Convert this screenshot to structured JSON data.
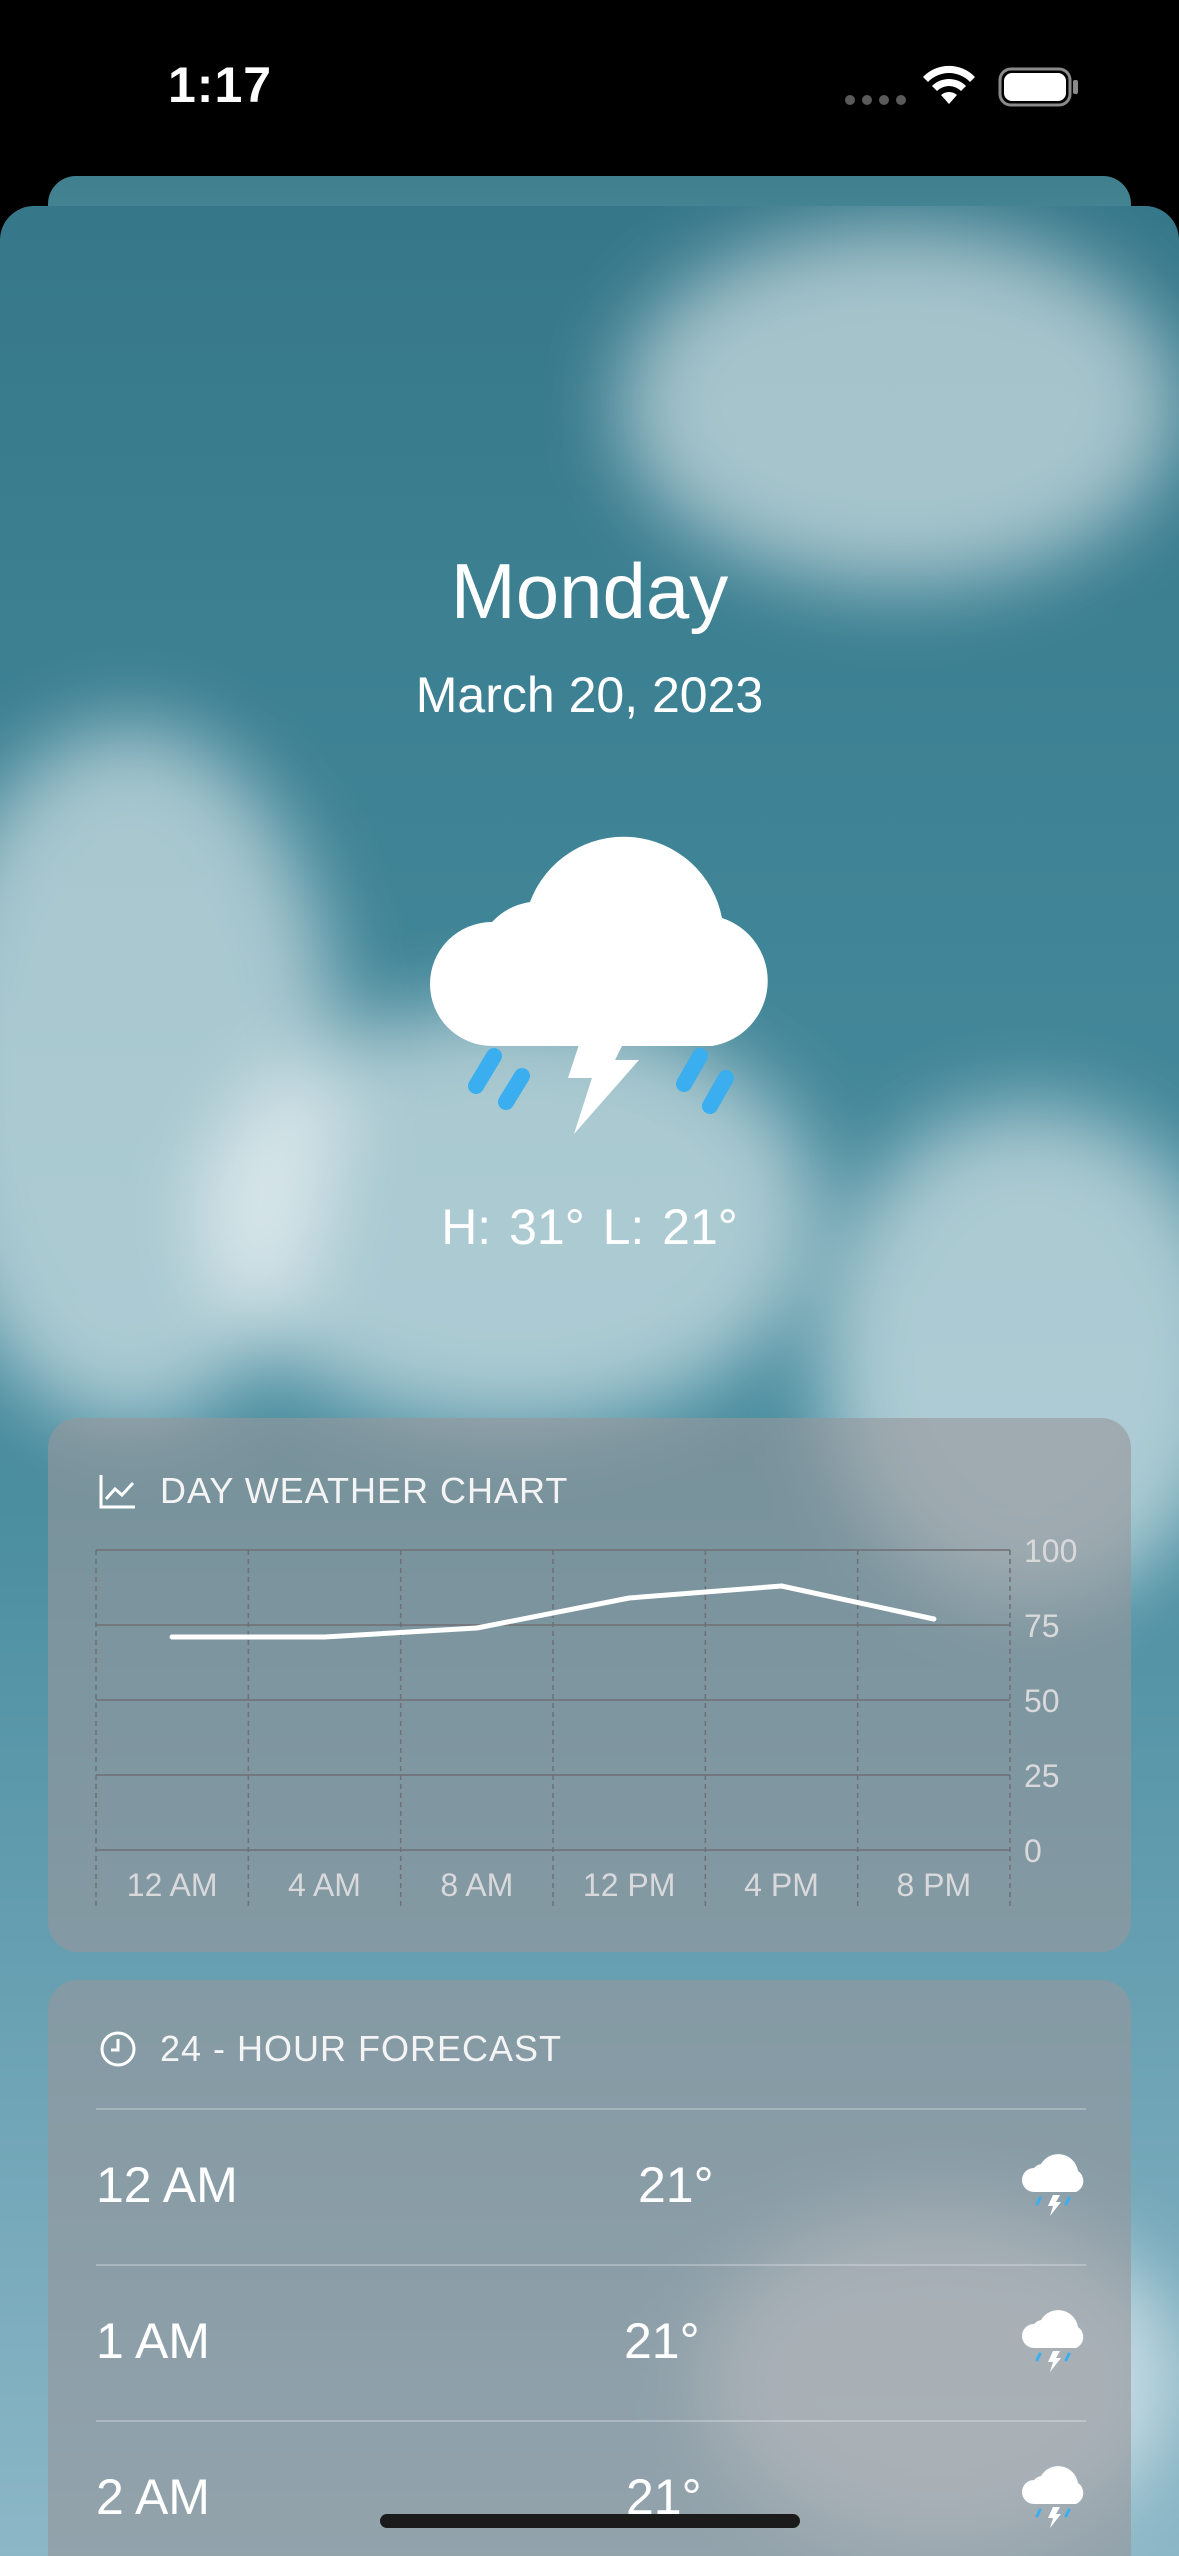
{
  "status_bar": {
    "time": "1:17"
  },
  "hero": {
    "day": "Monday",
    "date": "March 20, 2023",
    "condition_icon": "cloud-bolt-rain-icon",
    "high_low": "H: 31°  L: 21°"
  },
  "chart_card": {
    "title": "DAY WEATHER CHART",
    "icon": "line-chart-icon"
  },
  "chart_data": {
    "type": "line",
    "x": [
      "12 AM",
      "4 AM",
      "8 AM",
      "12 PM",
      "4 PM",
      "8 PM"
    ],
    "series": [
      {
        "values": [
          71,
          71,
          74,
          84,
          88,
          77
        ]
      }
    ],
    "ylim": [
      0,
      100
    ],
    "yticks": [
      100,
      75,
      50,
      25,
      0
    ],
    "grid": true,
    "colors": {
      "line": "#ffffff",
      "grid": "#6f6f74"
    }
  },
  "forecast_card": {
    "title": "24 - HOUR FORECAST",
    "icon": "clock-icon",
    "rows": [
      {
        "time": "12 AM",
        "temp": "21°",
        "icon": "cloud-bolt-rain-icon"
      },
      {
        "time": "1 AM",
        "temp": "21°",
        "icon": "cloud-bolt-rain-icon"
      },
      {
        "time": "2 AM",
        "temp": "21°",
        "icon": "cloud-bolt-rain-icon"
      }
    ]
  }
}
